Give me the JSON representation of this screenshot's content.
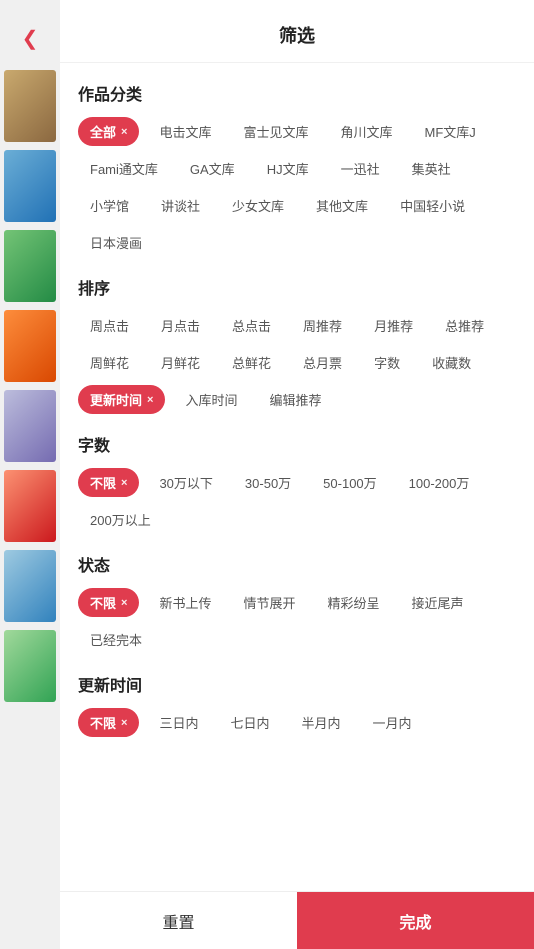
{
  "title": "筛选",
  "back_icon": "‹",
  "sections": {
    "category": {
      "label": "作品分类",
      "tags": [
        {
          "text": "全部",
          "active": true,
          "closeable": true
        },
        {
          "text": "电击文库",
          "active": false
        },
        {
          "text": "富士见文库",
          "active": false
        },
        {
          "text": "角川文库",
          "active": false
        },
        {
          "text": "MF文库J",
          "active": false
        },
        {
          "text": "Fami通文库",
          "active": false
        },
        {
          "text": "GA文库",
          "active": false
        },
        {
          "text": "HJ文库",
          "active": false
        },
        {
          "text": "一迅社",
          "active": false
        },
        {
          "text": "集英社",
          "active": false
        },
        {
          "text": "小学馆",
          "active": false
        },
        {
          "text": "讲谈社",
          "active": false
        },
        {
          "text": "少女文库",
          "active": false
        },
        {
          "text": "其他文库",
          "active": false
        },
        {
          "text": "中国轻小说",
          "active": false
        },
        {
          "text": "日本漫画",
          "active": false
        }
      ]
    },
    "sort": {
      "label": "排序",
      "tags": [
        {
          "text": "周点击",
          "active": false
        },
        {
          "text": "月点击",
          "active": false
        },
        {
          "text": "总点击",
          "active": false
        },
        {
          "text": "周推荐",
          "active": false
        },
        {
          "text": "月推荐",
          "active": false
        },
        {
          "text": "总推荐",
          "active": false
        },
        {
          "text": "周鲜花",
          "active": false
        },
        {
          "text": "月鲜花",
          "active": false
        },
        {
          "text": "总鲜花",
          "active": false
        },
        {
          "text": "总月票",
          "active": false
        },
        {
          "text": "字数",
          "active": false
        },
        {
          "text": "收藏数",
          "active": false
        },
        {
          "text": "更新时间",
          "active": true,
          "closeable": true
        },
        {
          "text": "入库时间",
          "active": false
        },
        {
          "text": "编辑推荐",
          "active": false
        }
      ]
    },
    "wordcount": {
      "label": "字数",
      "tags": [
        {
          "text": "不限",
          "active": true,
          "closeable": true
        },
        {
          "text": "30万以下",
          "active": false
        },
        {
          "text": "30-50万",
          "active": false
        },
        {
          "text": "50-100万",
          "active": false
        },
        {
          "text": "100-200万",
          "active": false
        },
        {
          "text": "200万以上",
          "active": false
        }
      ]
    },
    "status": {
      "label": "状态",
      "tags": [
        {
          "text": "不限",
          "active": true,
          "closeable": true
        },
        {
          "text": "新书上传",
          "active": false
        },
        {
          "text": "情节展开",
          "active": false
        },
        {
          "text": "精彩纷呈",
          "active": false
        },
        {
          "text": "接近尾声",
          "active": false
        },
        {
          "text": "已经完本",
          "active": false
        }
      ]
    },
    "update_time": {
      "label": "更新时间",
      "tags": [
        {
          "text": "不限",
          "active": true,
          "closeable": true
        },
        {
          "text": "三日内",
          "active": false
        },
        {
          "text": "七日内",
          "active": false
        },
        {
          "text": "半月内",
          "active": false
        },
        {
          "text": "一月内",
          "active": false
        }
      ]
    }
  },
  "footer": {
    "reset_label": "重置",
    "done_label": "完成"
  }
}
